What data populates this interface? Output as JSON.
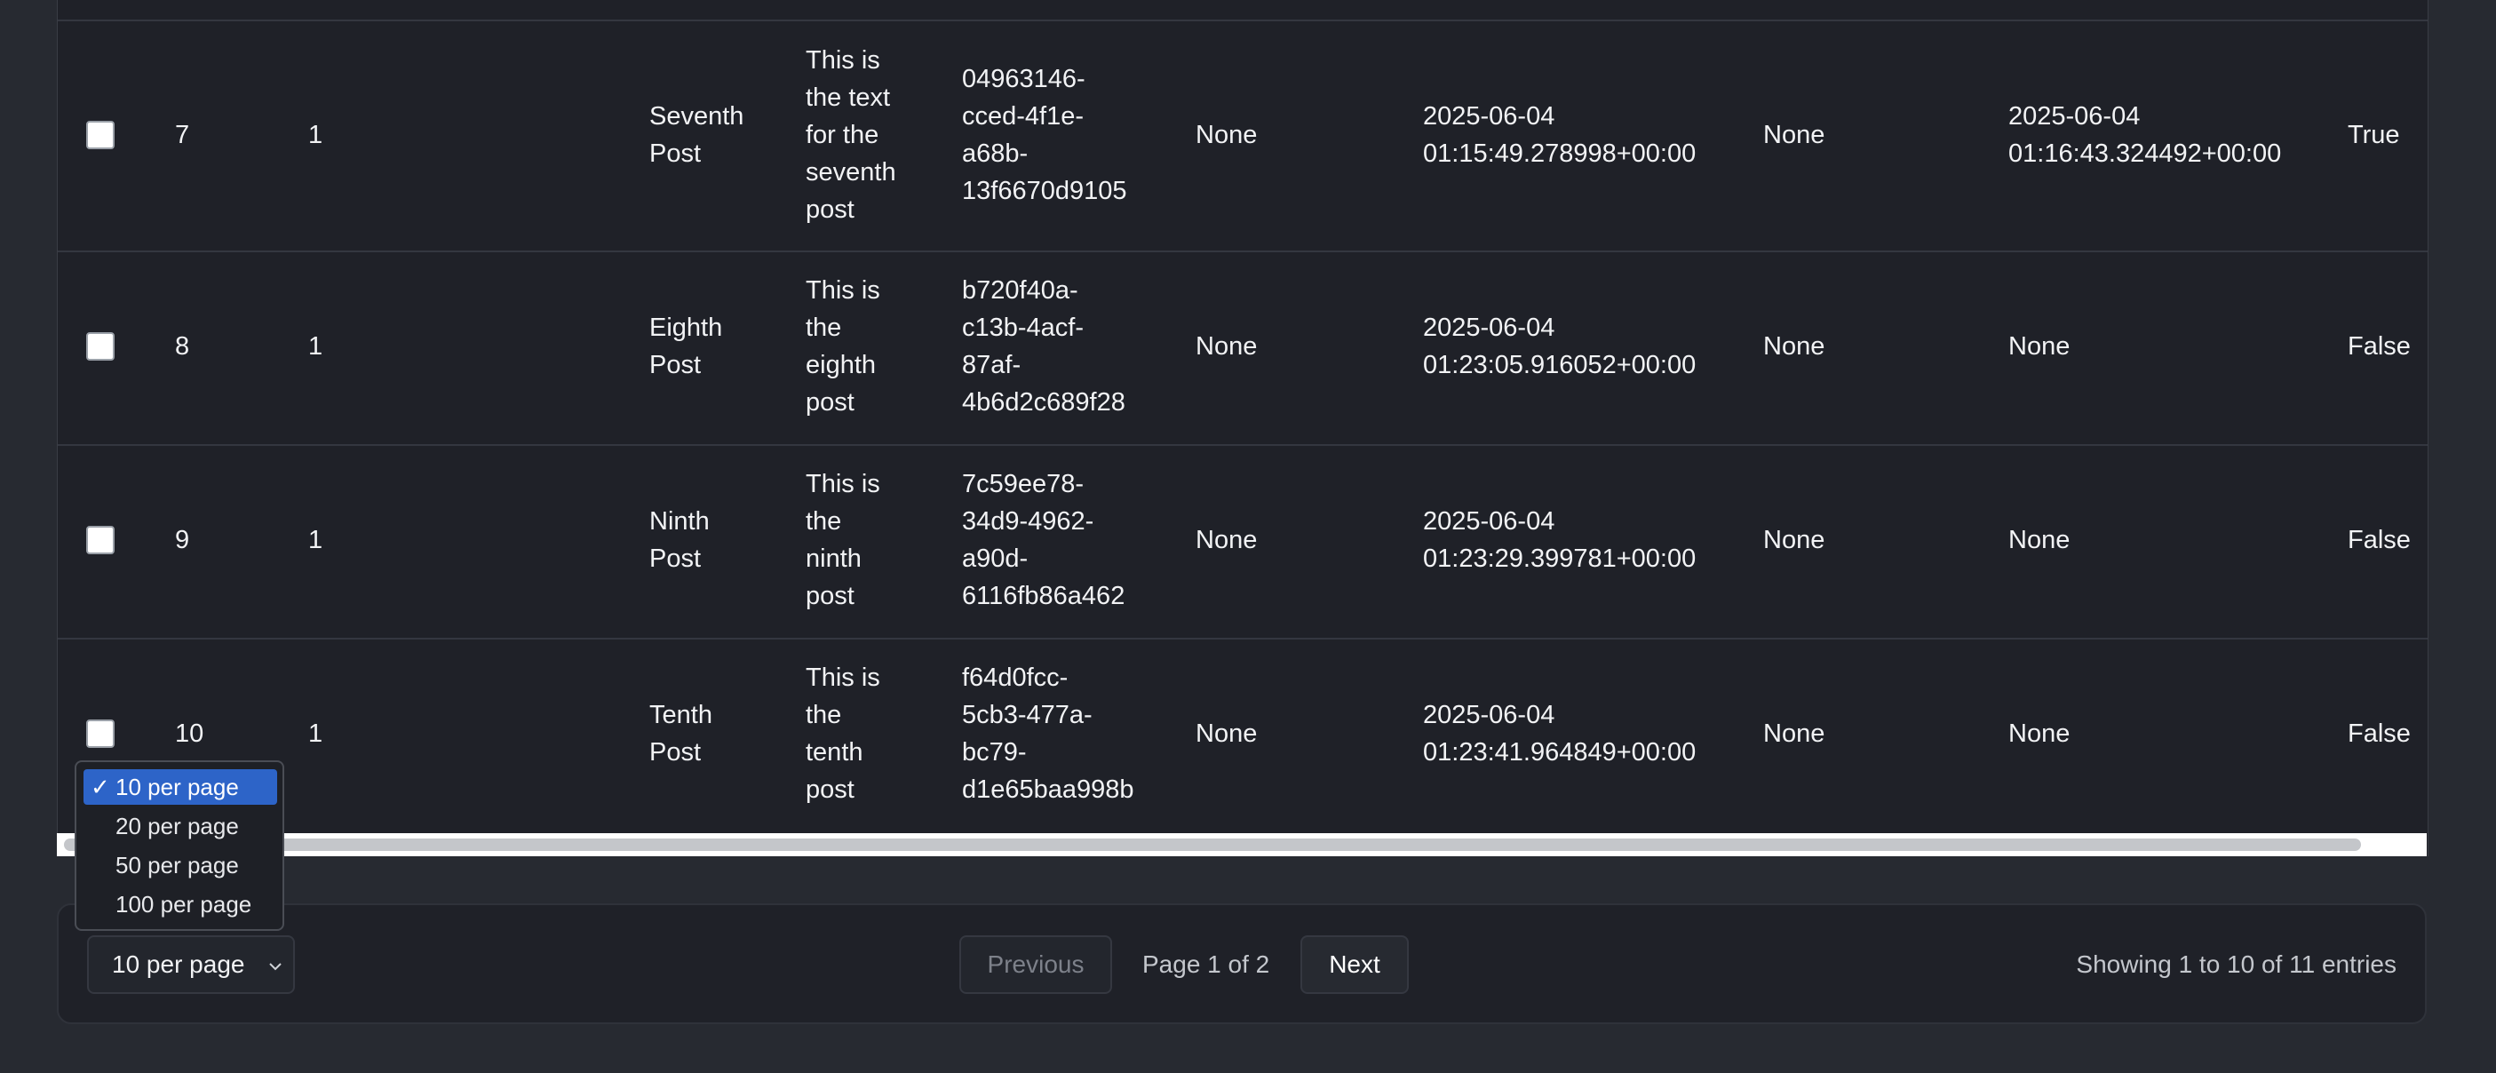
{
  "table": {
    "rows": [
      {
        "id": "7",
        "user": "1",
        "title": "Seventh\nPost",
        "body": "This is\nthe text\nfor the\nseventh\npost",
        "uuid": "04963146-\ncced-4f1e-\na68b-\n13f6670d9105",
        "c1": "None",
        "created": "2025-06-04\n01:15:49.278998+00:00",
        "c2": "None",
        "updated": "2025-06-04\n01:16:43.324492+00:00",
        "flag": "True"
      },
      {
        "id": "8",
        "user": "1",
        "title": "Eighth\nPost",
        "body": "This is\nthe\neighth\npost",
        "uuid": "b720f40a-\nc13b-4acf-\n87af-\n4b6d2c689f28",
        "c1": "None",
        "created": "2025-06-04\n01:23:05.916052+00:00",
        "c2": "None",
        "updated": "None",
        "flag": "False"
      },
      {
        "id": "9",
        "user": "1",
        "title": "Ninth\nPost",
        "body": "This is\nthe\nninth\npost",
        "uuid": "7c59ee78-\n34d9-4962-\na90d-\n6116fb86a462",
        "c1": "None",
        "created": "2025-06-04\n01:23:29.399781+00:00",
        "c2": "None",
        "updated": "None",
        "flag": "False"
      },
      {
        "id": "10",
        "user": "1",
        "title": "Tenth\nPost",
        "body": "This is\nthe\ntenth\npost",
        "uuid": "f64d0fcc-\n5cb3-477a-\nbc79-\nd1e65baa998b",
        "c1": "None",
        "created": "2025-06-04\n01:23:41.964849+00:00",
        "c2": "None",
        "updated": "None",
        "flag": "False"
      }
    ]
  },
  "pagination": {
    "per_page_value": "10 per page",
    "per_page_options": [
      "10 per page",
      "20 per page",
      "50 per page",
      "100 per page"
    ],
    "selected_check": "✓",
    "previous_label": "Previous",
    "next_label": "Next",
    "page_info": "Page 1 of 2",
    "entries_info": "Showing 1 to 10 of 11 entries"
  },
  "colors": {
    "background": "#272a31",
    "table_background": "#1f2128",
    "selected_option": "#2d64c8"
  }
}
